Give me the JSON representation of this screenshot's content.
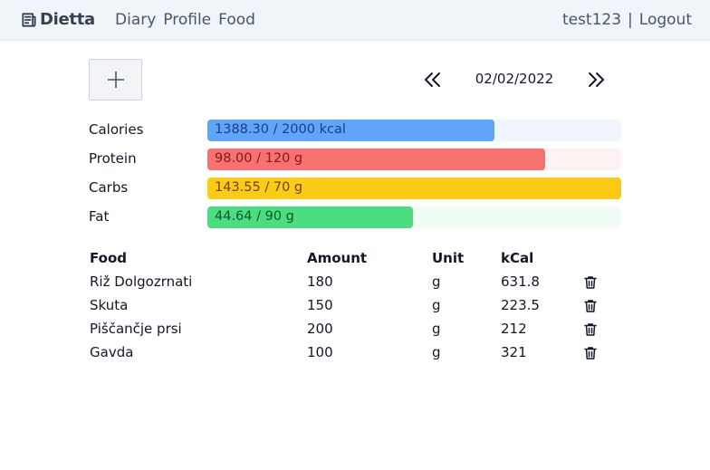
{
  "navbar": {
    "brand": "Dietta",
    "links": [
      "Diary",
      "Profile",
      "Food"
    ],
    "user": "test123",
    "separator": "|",
    "logout": "Logout"
  },
  "toolbar": {
    "add_icon": "plus-icon",
    "date": "02/02/2022",
    "prev_icon": "chevrons-left-icon",
    "next_icon": "chevrons-right-icon"
  },
  "macros": [
    {
      "label": "Calories",
      "value": "1388.30 / 2000 kcal",
      "current": 1388.3,
      "target": 2000,
      "fill": "#60a5fa",
      "track": "#eff6ff",
      "text_color": "#1e3a8a"
    },
    {
      "label": "Protein",
      "value": "98.00 / 120 g",
      "current": 98.0,
      "target": 120,
      "fill": "#f87171",
      "track": "#fef2f2",
      "text_color": "#7f1d1d"
    },
    {
      "label": "Carbs",
      "value": "143.55 / 70 g",
      "current": 143.55,
      "target": 70,
      "fill": "#facc15",
      "track": "#fefce8",
      "text_color": "#713f12"
    },
    {
      "label": "Fat",
      "value": "44.64 / 90 g",
      "current": 44.64,
      "target": 90,
      "fill": "#4ade80",
      "track": "#f0fdf4",
      "text_color": "#14532d"
    }
  ],
  "table": {
    "headers": [
      "Food",
      "Amount",
      "Unit",
      "kCal"
    ],
    "rows": [
      {
        "food": "Riž Dolgozrnati",
        "amount": "180",
        "unit": "g",
        "kcal": "631.8"
      },
      {
        "food": "Skuta",
        "amount": "150",
        "unit": "g",
        "kcal": "223.5"
      },
      {
        "food": "Piščančje prsi",
        "amount": "200",
        "unit": "g",
        "kcal": "212"
      },
      {
        "food": "Gavda",
        "amount": "100",
        "unit": "g",
        "kcal": "321"
      }
    ],
    "delete_icon": "trash-icon"
  }
}
